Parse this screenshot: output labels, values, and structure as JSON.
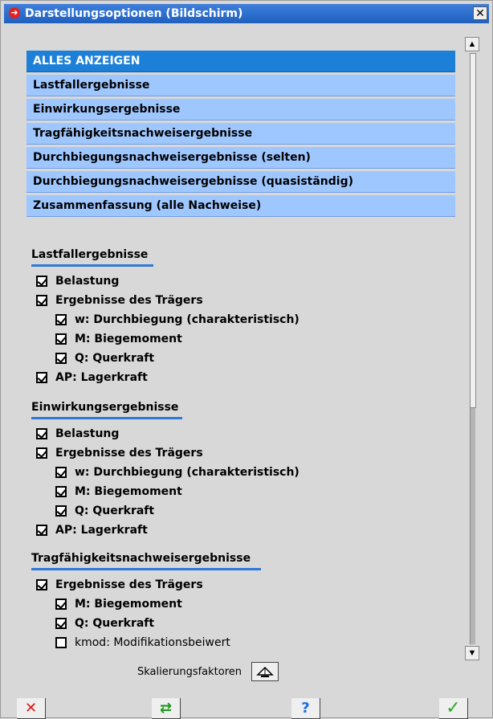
{
  "window": {
    "title": "Darstellungsoptionen (Bildschirm)",
    "close_glyph": "✕",
    "title_icon_glyph": "➜"
  },
  "nav": {
    "items": [
      "ALLES ANZEIGEN",
      "Lastfallergebnisse",
      "Einwirkungsergebnisse",
      "Tragfähigkeitsnachweisergebnisse",
      "Durchbiegungsnachweisergebnisse (selten)",
      "Durchbiegungsnachweisergebnisse (quasiständig)",
      "Zusammenfassung (alle Nachweise)"
    ],
    "selected_index": 0
  },
  "sections": [
    {
      "title": "Lastfallergebnisse",
      "options": [
        {
          "label": "Belastung",
          "checked": true
        },
        {
          "label": "Ergebnisse des Trägers",
          "checked": true
        },
        {
          "label": "w: Durchbiegung (charakteristisch)",
          "checked": true
        },
        {
          "label": "M: Biegemoment",
          "checked": true
        },
        {
          "label": "Q: Querkraft",
          "checked": true
        },
        {
          "label": "AP: Lagerkraft",
          "checked": true
        }
      ]
    },
    {
      "title": "Einwirkungsergebnisse",
      "options": [
        {
          "label": "Belastung",
          "checked": true
        },
        {
          "label": "Ergebnisse des Trägers",
          "checked": true
        },
        {
          "label": "w: Durchbiegung (charakteristisch)",
          "checked": true
        },
        {
          "label": "M: Biegemoment",
          "checked": true
        },
        {
          "label": "Q: Querkraft",
          "checked": true
        },
        {
          "label": "AP: Lagerkraft",
          "checked": true
        }
      ]
    },
    {
      "title": "Tragfähigkeitsnachweisergebnisse",
      "options": [
        {
          "label": "Ergebnisse des Trägers",
          "checked": true
        },
        {
          "label": "M: Biegemoment",
          "checked": true
        },
        {
          "label": "Q: Querkraft",
          "checked": true
        },
        {
          "label": "kmod: Modifikationsbeiwert",
          "checked": false
        }
      ]
    }
  ],
  "footer": {
    "scaling_label": "Skalierungsfaktoren",
    "cancel_glyph": "✕",
    "transfer_glyph": "⇄",
    "help_glyph": "?",
    "ok_glyph": "✓"
  },
  "scrollbar": {
    "up_glyph": "▲",
    "down_glyph": "▼",
    "position": 0.0
  },
  "colors": {
    "titlebar": "#2a6fd0",
    "nav_item": "#9fc7ff",
    "nav_selected": "#1d80d8",
    "section_underline": "#2f78d8"
  }
}
